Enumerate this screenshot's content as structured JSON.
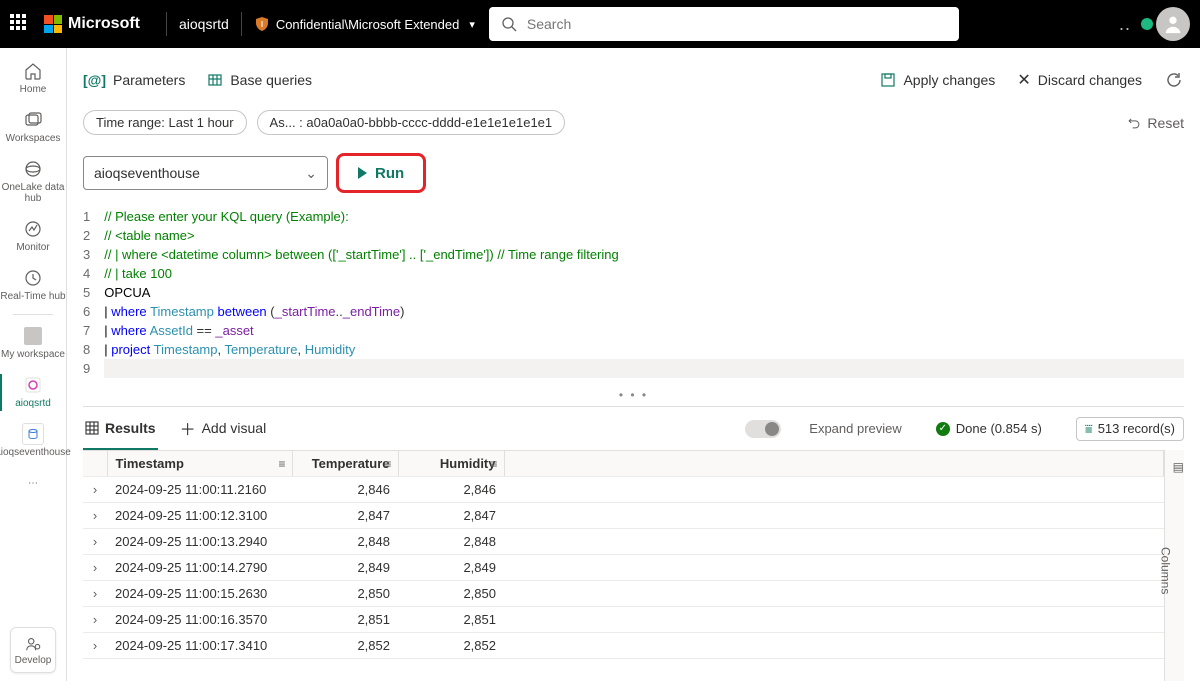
{
  "header": {
    "brand": "Microsoft",
    "context": "aioqsrtd",
    "sensitivity": "Confidential\\Microsoft Extended",
    "search_placeholder": "Search"
  },
  "rail": {
    "home": "Home",
    "workspaces": "Workspaces",
    "datahub": "OneLake data hub",
    "monitor": "Monitor",
    "realtime": "Real-Time hub",
    "myws": "My workspace",
    "active": "aioqsrtd",
    "eventhouse": "aioqseventhouse",
    "develop": "Develop"
  },
  "toolbar": {
    "parameters": "Parameters",
    "base_queries": "Base queries",
    "apply": "Apply changes",
    "discard": "Discard changes"
  },
  "pills": {
    "time_range": "Time range: Last 1 hour",
    "asset": "As... : a0a0a0a0-bbbb-cccc-dddd-e1e1e1e1e1e1",
    "reset": "Reset"
  },
  "query": {
    "database": "aioqseventhouse",
    "run": "Run",
    "lines": [
      "// Please enter your KQL query (Example):",
      "// <table name>",
      "// | where <datetime column> between (['_startTime'] .. ['_endTime']) // Time range filtering",
      "// | take 100",
      "OPCUA",
      "| where Timestamp between (_startTime.._endTime)",
      "| where AssetId == _asset",
      "| project Timestamp, Temperature, Humidity",
      ""
    ]
  },
  "results": {
    "tab_results": "Results",
    "add_visual": "Add visual",
    "expand_preview": "Expand preview",
    "status": "Done (0.854 s)",
    "record_count": "513 record(s)",
    "columns_label": "Columns",
    "headers": {
      "ts": "Timestamp",
      "temp": "Temperature",
      "hum": "Humidity"
    },
    "rows": [
      {
        "ts": "2024-09-25 11:00:11.2160",
        "temp": "2,846",
        "hum": "2,846"
      },
      {
        "ts": "2024-09-25 11:00:12.3100",
        "temp": "2,847",
        "hum": "2,847"
      },
      {
        "ts": "2024-09-25 11:00:13.2940",
        "temp": "2,848",
        "hum": "2,848"
      },
      {
        "ts": "2024-09-25 11:00:14.2790",
        "temp": "2,849",
        "hum": "2,849"
      },
      {
        "ts": "2024-09-25 11:00:15.2630",
        "temp": "2,850",
        "hum": "2,850"
      },
      {
        "ts": "2024-09-25 11:00:16.3570",
        "temp": "2,851",
        "hum": "2,851"
      },
      {
        "ts": "2024-09-25 11:00:17.3410",
        "temp": "2,852",
        "hum": "2,852"
      }
    ]
  }
}
